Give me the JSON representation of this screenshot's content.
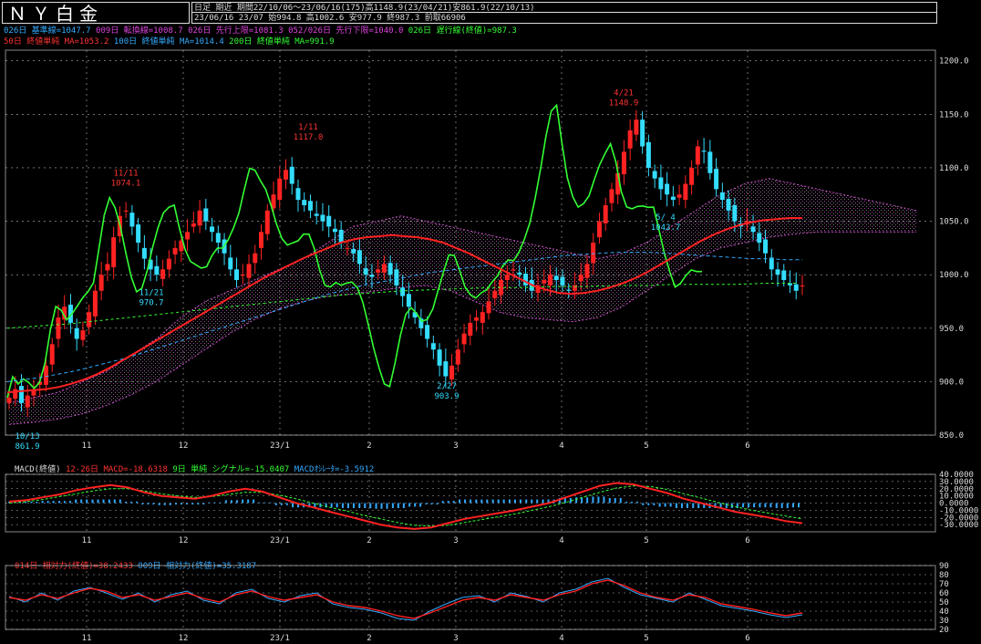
{
  "header": {
    "title": "ＮＹ白金",
    "period_line": "日足 期近  期間22/10/06～23/06/16(175)高1148.9(23/04/21)安861.9(22/10/13)",
    "ohlc_line": "23/06/16 23/07 始994.8 高1002.6 安977.9 終987.3 前取66906"
  },
  "legend": {
    "line1": [
      {
        "text": "026日 基準線=1047.7",
        "color": "#33aaff"
      },
      {
        "text": "009日 転換線=1008.7",
        "color": "#dd44dd"
      },
      {
        "text": "026日 先行上限=1081.3",
        "color": "#dd44dd"
      },
      {
        "text": "052/026日 先行下限=1040.0",
        "color": "#dd44dd"
      },
      {
        "text": "026日 遅行線(終値)=987.3",
        "color": "#33ff33"
      }
    ],
    "line2": [
      {
        "text": "50日 終値単純 MA=1053.2",
        "color": "#ff3333"
      },
      {
        "text": "100日 終値単純 MA=1014.4",
        "color": "#33aaff"
      },
      {
        "text": "200日 終値単純 MA=991.9",
        "color": "#33ff33"
      }
    ]
  },
  "macd_legend": [
    {
      "text": "MACD(終値)",
      "color": "#dddddd"
    },
    {
      "text": "12-26日 MACD=-18.6318",
      "color": "#ff3333"
    },
    {
      "text": "9日 単純 シグナル=-15.0407",
      "color": "#33ff33"
    },
    {
      "text": "MACDｵｼﾚｰﾀ=-3.5912",
      "color": "#33aaff"
    }
  ],
  "rsi_legend": [
    {
      "text": "014日 相対力(終値)=38.2433",
      "color": "#ff3333"
    },
    {
      "text": "009日 相対力(終値)=35.3187",
      "color": "#33aaff"
    }
  ],
  "colors": {
    "up": "#ff2222",
    "down": "#33ddff",
    "ma50": "#ff2222",
    "ma100": "#33aaff",
    "ma200": "#33ff33",
    "lagging": "#33ff33",
    "cloud": "#cc55cc",
    "grid": "#ffffff"
  },
  "chart_data": [
    {
      "type": "candlestick",
      "title": "ＮＹ白金",
      "ylim": [
        850,
        1210
      ],
      "yticks": [
        "1200.0",
        "1150.0",
        "1100.0",
        "1050.0",
        "1000.0",
        "950.0",
        "900.0",
        "850.0"
      ],
      "x_tick_labels": [
        "11",
        "12",
        "23/1",
        "2",
        "3",
        "4",
        "5",
        "6"
      ],
      "annotations": [
        {
          "text": "10/13",
          "sub": "861.9",
          "color": "#33ddff"
        },
        {
          "text": "11/11",
          "sub": "1074.1",
          "color": "#ff3333"
        },
        {
          "text": "11/21",
          "sub": "970.7",
          "color": "#33ddff"
        },
        {
          "text": "1/11",
          "sub": "1117.0",
          "color": "#ff3333"
        },
        {
          "text": "2/27",
          "sub": "903.9",
          "color": "#33ddff"
        },
        {
          "text": "4/21",
          "sub": "1148.9",
          "color": "#ff3333"
        },
        {
          "text": "5/ 4",
          "sub": "1042.7",
          "color": "#33ddff"
        }
      ],
      "close_series": [
        885,
        893,
        880,
        887,
        893,
        900,
        915,
        935,
        960,
        970,
        955,
        940,
        948,
        965,
        985,
        1000,
        1010,
        1035,
        1055,
        1060,
        1045,
        1030,
        1015,
        1005,
        1000,
        1005,
        1015,
        1025,
        1032,
        1040,
        1048,
        1060,
        1050,
        1040,
        1030,
        1020,
        1005,
        995,
        1000,
        1010,
        1020,
        1040,
        1060,
        1075,
        1090,
        1098,
        1085,
        1070,
        1065,
        1060,
        1055,
        1050,
        1045,
        1040,
        1030,
        1025,
        1020,
        1010,
        1000,
        998,
        1005,
        1010,
        1000,
        990,
        980,
        970,
        960,
        950,
        940,
        930,
        915,
        905,
        915,
        930,
        945,
        955,
        960,
        965,
        975,
        985,
        995,
        1000,
        1005,
        1000,
        990,
        985,
        990,
        995,
        1000,
        995,
        990,
        985,
        990,
        1000,
        1010,
        1030,
        1050,
        1065,
        1080,
        1095,
        1115,
        1135,
        1145,
        1120,
        1100,
        1090,
        1080,
        1075,
        1070,
        1075,
        1085,
        1100,
        1120,
        1115,
        1095,
        1080,
        1070,
        1060,
        1050,
        1045,
        1050,
        1040,
        1030,
        1020,
        1005,
        1000,
        995,
        990,
        985,
        990
      ],
      "ma50": [
        890,
        891,
        892,
        893,
        895,
        898,
        902,
        907,
        913,
        920,
        927,
        934,
        941,
        948,
        955,
        962,
        969,
        976,
        983,
        990,
        997,
        1003,
        1009,
        1015,
        1020,
        1025,
        1030,
        1033,
        1035,
        1036,
        1037,
        1036,
        1035,
        1033,
        1030,
        1025,
        1020,
        1014,
        1008,
        1002,
        996,
        990,
        986,
        983,
        982,
        983,
        985,
        988,
        992,
        997,
        1003,
        1010,
        1017,
        1024,
        1031,
        1037,
        1042,
        1046,
        1049,
        1051,
        1052,
        1053,
        1053
      ],
      "ma100": [
        900,
        902,
        904,
        907,
        910,
        914,
        918,
        922,
        927,
        932,
        937,
        942,
        947,
        952,
        957,
        962,
        967,
        972,
        977,
        982,
        986,
        990,
        993,
        996,
        999,
        1002,
        1004,
        1006,
        1008,
        1010,
        1012,
        1014,
        1016,
        1018,
        1019,
        1020,
        1021,
        1021,
        1021,
        1020,
        1019,
        1018,
        1017,
        1016,
        1015,
        1015,
        1014,
        1014
      ],
      "ma200": [
        950,
        952,
        954,
        957,
        960,
        963,
        966,
        969,
        972,
        975,
        978,
        981,
        983,
        985,
        986,
        987,
        988,
        988,
        989,
        989,
        990,
        990,
        991,
        991,
        991,
        992,
        992
      ],
      "cloud_upper": [
        880,
        885,
        890,
        900,
        910,
        925,
        940,
        960,
        975,
        985,
        995,
        1005,
        1015,
        1030,
        1045,
        1050,
        1055,
        1050,
        1045,
        1040,
        1035,
        1030,
        1025,
        1020,
        1015,
        1020,
        1030,
        1045,
        1060,
        1075,
        1085,
        1090,
        1085,
        1080,
        1075,
        1070,
        1065,
        1060
      ],
      "cloud_lower": [
        860,
        862,
        865,
        870,
        878,
        888,
        900,
        915,
        930,
        945,
        958,
        968,
        975,
        980,
        982,
        985,
        988,
        990,
        985,
        975,
        965,
        960,
        958,
        956,
        960,
        970,
        985,
        1000,
        1015,
        1025,
        1030,
        1035,
        1038,
        1040,
        1040,
        1040,
        1040,
        1040
      ]
    },
    {
      "type": "line",
      "title": "MACD(終値)",
      "ylim": [
        -40,
        40
      ],
      "yticks": [
        "40.0000",
        "30.0000",
        "20.0000",
        "10.0000",
        "0.0000",
        "-10.0000",
        "-20.0000",
        "-30.0000"
      ],
      "series": [
        {
          "name": "12-26日 MACD",
          "values": [
            2,
            4,
            8,
            12,
            18,
            22,
            25,
            22,
            15,
            10,
            8,
            6,
            10,
            16,
            20,
            16,
            8,
            0,
            -6,
            -12,
            -18,
            -24,
            -30,
            -34,
            -36,
            -34,
            -28,
            -22,
            -18,
            -14,
            -10,
            -5,
            0,
            8,
            16,
            24,
            28,
            26,
            20,
            14,
            6,
            0,
            -6,
            -12,
            -16,
            -20,
            -25,
            -28
          ]
        },
        {
          "name": "9日 単純 シグナル",
          "values": [
            0,
            2,
            5,
            9,
            13,
            17,
            20,
            20,
            17,
            13,
            10,
            8,
            9,
            12,
            15,
            15,
            11,
            6,
            0,
            -6,
            -11,
            -17,
            -22,
            -27,
            -31,
            -32,
            -31,
            -27,
            -23,
            -19,
            -15,
            -10,
            -5,
            1,
            8,
            15,
            21,
            24,
            23,
            19,
            13,
            7,
            1,
            -5,
            -10,
            -14,
            -18,
            -22
          ]
        },
        {
          "name": "MACDｵｼﾚｰﾀ",
          "values": [
            2,
            2,
            3,
            3,
            5,
            5,
            5,
            2,
            -2,
            -3,
            -2,
            -2,
            1,
            4,
            5,
            1,
            -3,
            -6,
            -6,
            -6,
            -7,
            -7,
            -8,
            -7,
            -5,
            -2,
            3,
            5,
            5,
            5,
            5,
            5,
            5,
            7,
            8,
            9,
            7,
            2,
            -3,
            -5,
            -7,
            -7,
            -7,
            -7,
            -6,
            -6,
            -7,
            -6
          ]
        }
      ]
    },
    {
      "type": "line",
      "title": "相対力(終値)",
      "ylim": [
        20,
        90
      ],
      "yticks": [
        "90",
        "80",
        "70",
        "60",
        "50",
        "40",
        "30",
        "20"
      ],
      "series": [
        {
          "name": "014日 相対力",
          "values": [
            55,
            52,
            58,
            54,
            60,
            65,
            62,
            55,
            58,
            52,
            56,
            60,
            54,
            50,
            58,
            62,
            56,
            52,
            55,
            58,
            50,
            46,
            44,
            40,
            35,
            32,
            38,
            45,
            52,
            55,
            52,
            58,
            55,
            52,
            58,
            62,
            70,
            74,
            68,
            60,
            55,
            52,
            58,
            55,
            48,
            45,
            42,
            38,
            35,
            38
          ]
        },
        {
          "name": "009日 相対力",
          "values": [
            56,
            50,
            60,
            52,
            62,
            66,
            60,
            53,
            60,
            50,
            58,
            62,
            52,
            48,
            60,
            64,
            54,
            50,
            57,
            60,
            48,
            44,
            42,
            38,
            32,
            30,
            40,
            48,
            55,
            57,
            50,
            60,
            56,
            50,
            60,
            64,
            72,
            76,
            66,
            58,
            54,
            50,
            60,
            53,
            46,
            43,
            40,
            36,
            33,
            36
          ]
        }
      ]
    }
  ]
}
